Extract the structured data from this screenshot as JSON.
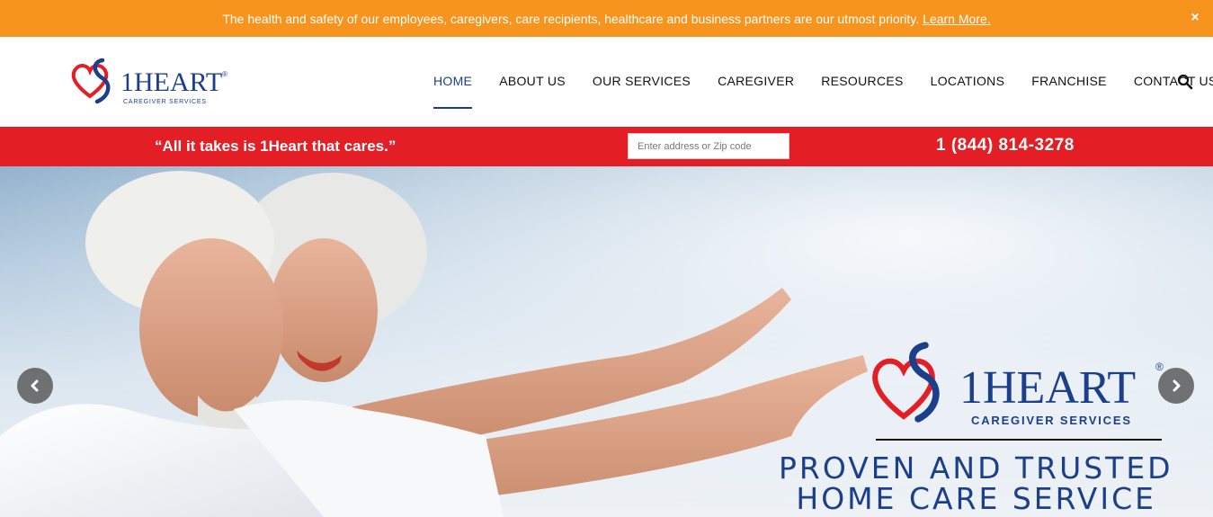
{
  "notice": {
    "text": "The health and safety of our employees, caregivers, care recipients, healthcare and business partners are our utmost priority.",
    "link": "Learn More.",
    "close": "×"
  },
  "brand": {
    "name": "1Heart",
    "name_display": "1HEART",
    "subtitle": "CAREGIVER SERVICES",
    "registered": "®",
    "colors": {
      "red": "#e31e24",
      "navy": "#1b3f8b",
      "orange": "#f7941d"
    }
  },
  "nav": {
    "items": [
      {
        "label": "HOME",
        "active": true
      },
      {
        "label": "ABOUT US"
      },
      {
        "label": "OUR SERVICES"
      },
      {
        "label": "CAREGIVER"
      },
      {
        "label": "RESOURCES"
      },
      {
        "label": "LOCATIONS"
      },
      {
        "label": "FRANCHISE"
      },
      {
        "label": "CONTACT US"
      }
    ],
    "search_icon": "search-icon"
  },
  "redbar": {
    "tagline": "“All it takes is 1Heart that cares.”",
    "zip_placeholder": "Enter address or Zip code",
    "phone": "1 (844) 814-3278"
  },
  "hero": {
    "line1": "PROVEN AND TRUSTED",
    "line2": "HOME CARE SERVICE",
    "prev_icon": "chevron-left-icon",
    "next_icon": "chevron-right-icon"
  }
}
